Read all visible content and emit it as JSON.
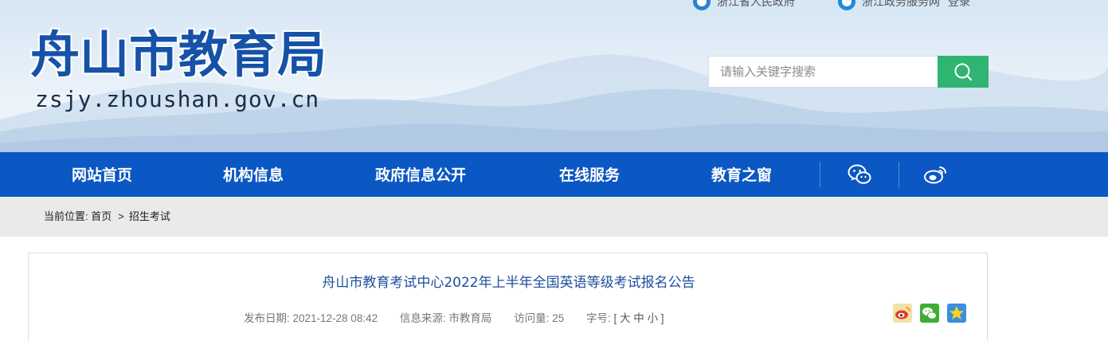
{
  "header": {
    "top_links": [
      {
        "label": "浙江省人民政府",
        "icon": "zhejiang-gov-icon"
      },
      {
        "label": "浙江政务服务网",
        "icon": "zjzwfw-icon"
      },
      {
        "label": "登录"
      }
    ],
    "site_title": "舟山市教育局",
    "site_domain": "zsjy.zhoushan.gov.cn",
    "search": {
      "placeholder": "请输入关键字搜索",
      "value": "",
      "button_icon": "search-icon"
    }
  },
  "nav": {
    "items": [
      {
        "label": "网站首页"
      },
      {
        "label": "机构信息"
      },
      {
        "label": "政府信息公开"
      },
      {
        "label": "在线服务"
      },
      {
        "label": "教育之窗"
      }
    ],
    "icons": [
      "wechat-icon",
      "weibo-icon"
    ]
  },
  "breadcrumb": {
    "prefix": "当前位置:",
    "items": [
      "首页",
      "招生考试"
    ],
    "separator": ">"
  },
  "article": {
    "title": "舟山市教育考试中心2022年上半年全国英语等级考试报名公告",
    "publish_date": "发布日期: 2021-12-28 08:42",
    "source": "信息来源: 市教育局",
    "views": "访问量: 25",
    "font_size_label": "字号:",
    "font_size_open": "[",
    "font_sizes": [
      "大",
      "中",
      "小"
    ],
    "font_size_close": "]",
    "share_icons": [
      "weibo-share-icon",
      "wechat-share-icon",
      "qzone-share-icon"
    ]
  },
  "colors": {
    "nav_bg": "#0b57c3",
    "title_blue": "#1552a8",
    "search_green": "#2fb472",
    "crumb_bg": "#eaeaea",
    "article_title": "#1e4e9a"
  }
}
